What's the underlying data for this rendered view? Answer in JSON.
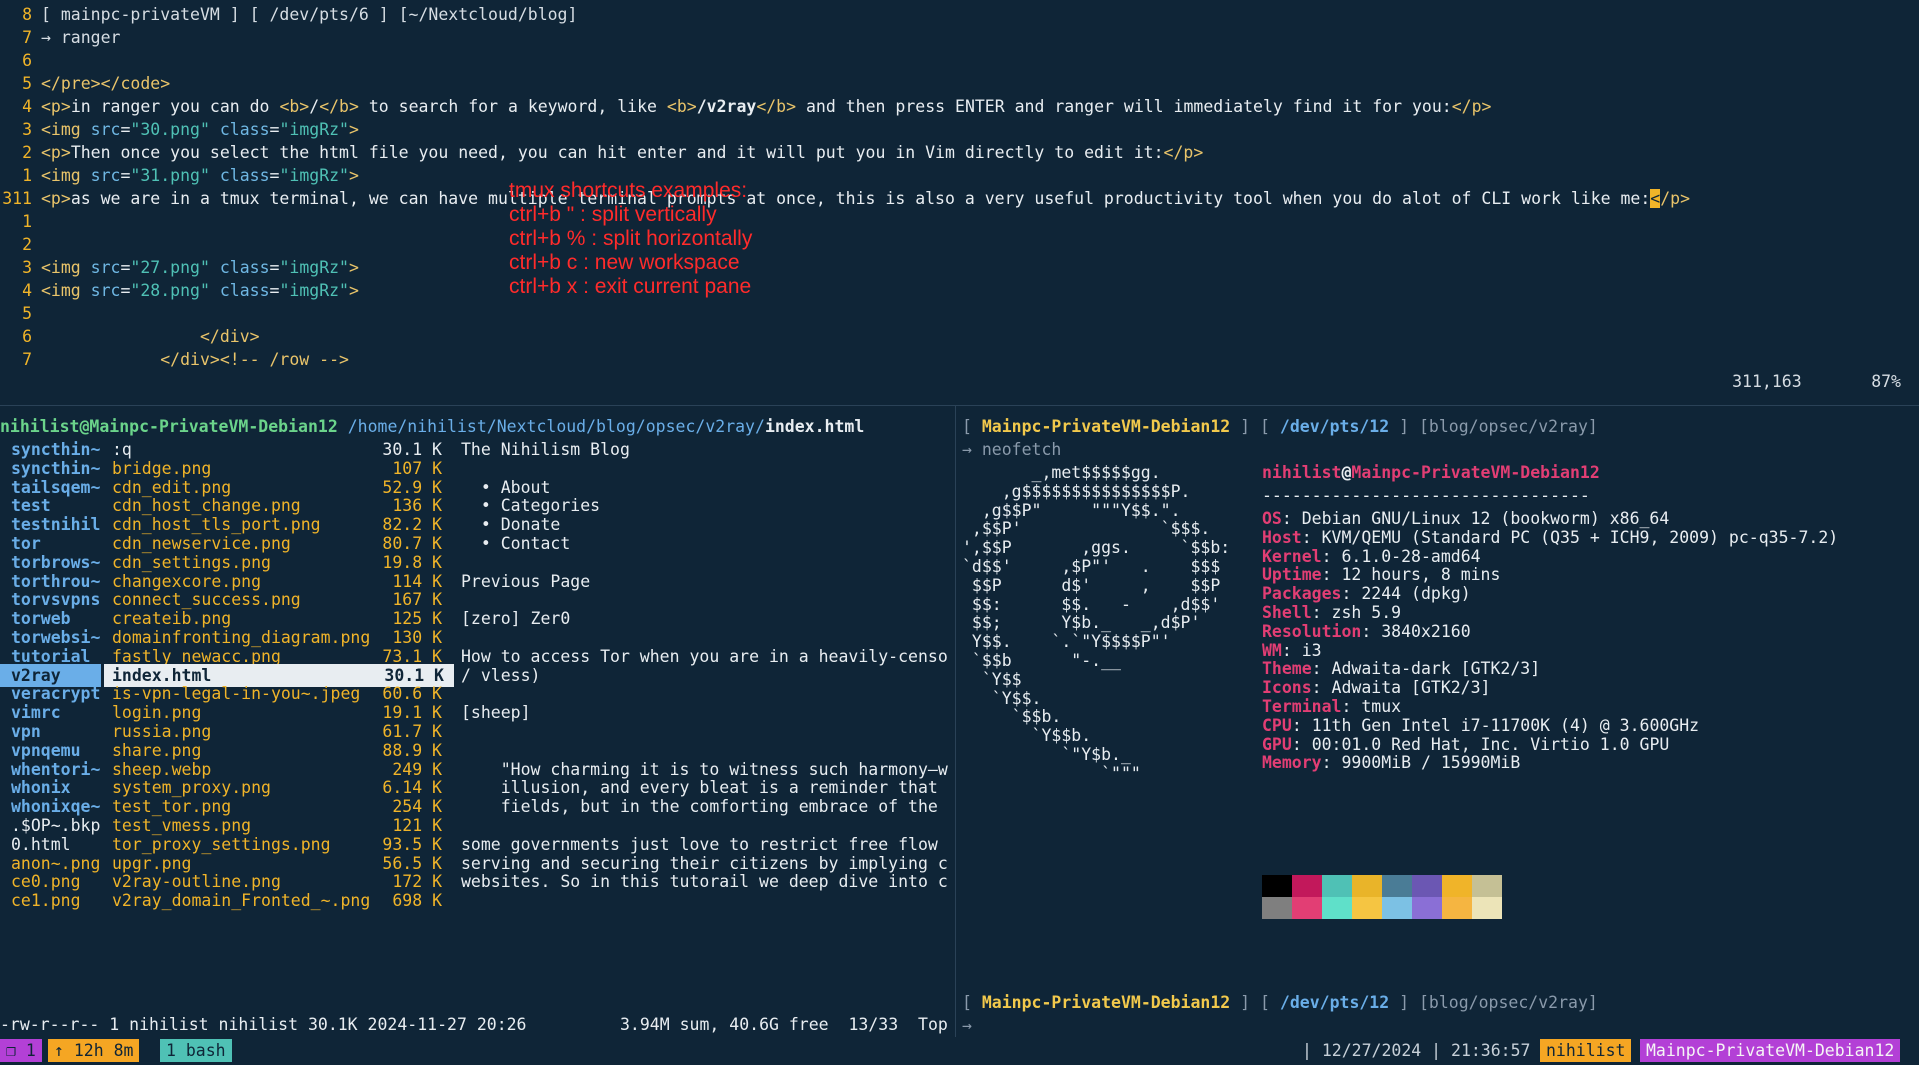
{
  "vim": {
    "lines": [
      {
        "num": "8",
        "html": "[ mainpc-privateVM ] [ /dev/pts/6 ] [~/Nextcloud/blog]"
      },
      {
        "num": "7",
        "html": "→ ranger"
      },
      {
        "num": "6",
        "html": ""
      },
      {
        "num": "5",
        "text": "</pre></code>"
      },
      {
        "num": "4",
        "parts": [
          [
            "tag",
            "<p>"
          ],
          [
            "w",
            "in ranger you can do "
          ],
          [
            "tag",
            "<b>"
          ],
          [
            "w",
            "/"
          ],
          [
            "tag",
            "</b>"
          ],
          [
            "w",
            " to search for a keyword, like "
          ],
          [
            "tag",
            "<b>"
          ],
          [
            "wb",
            "/v2ray"
          ],
          [
            "tag",
            "</b>"
          ],
          [
            "w",
            " and then press ENTER and ranger will immediately find it for you:"
          ],
          [
            "tag",
            "</p>"
          ]
        ]
      },
      {
        "num": "3",
        "parts": [
          [
            "tag",
            "<img "
          ],
          [
            "attr",
            "src"
          ],
          [
            "w",
            "="
          ],
          [
            "str",
            "\"30.png\""
          ],
          [
            "w",
            " "
          ],
          [
            "attr",
            "class"
          ],
          [
            "w",
            "="
          ],
          [
            "str",
            "\"imgRz\""
          ],
          [
            "tag",
            ">"
          ]
        ]
      },
      {
        "num": "2",
        "parts": [
          [
            "tag",
            "<p>"
          ],
          [
            "w",
            "Then once you select the html file you need, you can hit enter and it will put you in Vim directly to edit it:"
          ],
          [
            "tag",
            "</p>"
          ]
        ]
      },
      {
        "num": "1",
        "parts": [
          [
            "tag",
            "<img "
          ],
          [
            "attr",
            "src"
          ],
          [
            "w",
            "="
          ],
          [
            "str",
            "\"31.png\""
          ],
          [
            "w",
            " "
          ],
          [
            "attr",
            "class"
          ],
          [
            "w",
            "="
          ],
          [
            "str",
            "\"imgRz\""
          ],
          [
            "tag",
            ">"
          ]
        ]
      },
      {
        "num": "311",
        "cur": true,
        "parts": [
          [
            "tag",
            "<p>"
          ],
          [
            "w",
            "as we are in a tmux terminal, we can have multiple terminal prompts at once, this is also a very useful productivity tool when you do alot of CLI work like me:"
          ],
          [
            "cursor",
            "<"
          ],
          [
            "tag",
            "/p>"
          ]
        ]
      },
      {
        "num": "1",
        "parts": []
      },
      {
        "num": "2",
        "parts": []
      },
      {
        "num": "3",
        "parts": [
          [
            "tag",
            "<img "
          ],
          [
            "attr",
            "src"
          ],
          [
            "w",
            "="
          ],
          [
            "str",
            "\"27.png\""
          ],
          [
            "w",
            " "
          ],
          [
            "attr",
            "class"
          ],
          [
            "w",
            "="
          ],
          [
            "str",
            "\"imgRz\""
          ],
          [
            "tag",
            ">"
          ]
        ]
      },
      {
        "num": "4",
        "parts": [
          [
            "tag",
            "<img "
          ],
          [
            "attr",
            "src"
          ],
          [
            "w",
            "="
          ],
          [
            "str",
            "\"28.png\""
          ],
          [
            "w",
            " "
          ],
          [
            "attr",
            "class"
          ],
          [
            "w",
            "="
          ],
          [
            "str",
            "\"imgRz\""
          ],
          [
            "tag",
            ">"
          ]
        ]
      },
      {
        "num": "5",
        "parts": []
      },
      {
        "num": "6",
        "parts": [
          [
            "w",
            "                "
          ],
          [
            "tag",
            "</div>"
          ]
        ]
      },
      {
        "num": "7",
        "parts": [
          [
            "w",
            "            "
          ],
          [
            "tag",
            "</div>"
          ],
          [
            "cmt",
            "<!-- /row -->"
          ]
        ]
      }
    ],
    "status_pos": "311,163",
    "status_pct": "87%",
    "annotation": [
      "tmux shortcuts examples:",
      "ctrl+b \" : split vertically",
      "ctrl+b % : split horizontally",
      "ctrl+b c : new workspace",
      "ctrl+b x : exit current pane"
    ]
  },
  "ranger": {
    "header_user": "nihilist@Mainpc-PrivateVM-Debian12",
    "header_path": "/home/nihilist/Nextcloud/blog/opsec/v2ray/",
    "header_file": "index.html",
    "parent_dirs": [
      {
        "name": "syncthin~",
        "type": "dir"
      },
      {
        "name": "syncthin~",
        "type": "dir"
      },
      {
        "name": "tailsqem~",
        "type": "dir"
      },
      {
        "name": "test",
        "type": "dir"
      },
      {
        "name": "testnihil",
        "type": "dir"
      },
      {
        "name": "tor",
        "type": "dir"
      },
      {
        "name": "torbrows~",
        "type": "dir"
      },
      {
        "name": "torthrou~",
        "type": "dir"
      },
      {
        "name": "torvsvpns",
        "type": "dir"
      },
      {
        "name": "torweb",
        "type": "dir"
      },
      {
        "name": "torwebsi~",
        "type": "dir"
      },
      {
        "name": "tutorial",
        "type": "dir"
      },
      {
        "name": "v2ray",
        "type": "sel"
      },
      {
        "name": "veracrypt",
        "type": "dir"
      },
      {
        "name": "vimrc",
        "type": "dir"
      },
      {
        "name": "vpn",
        "type": "dir"
      },
      {
        "name": "vpnqemu",
        "type": "dir"
      },
      {
        "name": "whentori~",
        "type": "dir"
      },
      {
        "name": "whonix",
        "type": "dir"
      },
      {
        "name": "whonixqe~",
        "type": "dir"
      },
      {
        "name": ".$OP~.bkp",
        "type": "plain"
      },
      {
        "name": "0.html",
        "type": "plain"
      },
      {
        "name": "anon~.png",
        "type": "file"
      },
      {
        "name": "ce0.png",
        "type": "file"
      },
      {
        "name": "ce1.png",
        "type": "file"
      }
    ],
    "files": [
      {
        "name": ":q",
        "size": "30.1 K",
        "type": "plain"
      },
      {
        "name": "bridge.png",
        "size": "107 K",
        "type": "file"
      },
      {
        "name": "cdn_edit.png",
        "size": "52.9 K",
        "type": "file"
      },
      {
        "name": "cdn_host_change.png",
        "size": "136 K",
        "type": "file"
      },
      {
        "name": "cdn_host_tls_port.png",
        "size": "82.2 K",
        "type": "file"
      },
      {
        "name": "cdn_newservice.png",
        "size": "80.7 K",
        "type": "file"
      },
      {
        "name": "cdn_settings.png",
        "size": "19.8 K",
        "type": "file"
      },
      {
        "name": "changexcore.png",
        "size": "114 K",
        "type": "file"
      },
      {
        "name": "connect_success.png",
        "size": "167 K",
        "type": "file"
      },
      {
        "name": "createib.png",
        "size": "125 K",
        "type": "file"
      },
      {
        "name": "domainfronting_diagram.png",
        "size": "130 K",
        "type": "file"
      },
      {
        "name": "fastly_newacc.png",
        "size": "73.1 K",
        "type": "file"
      },
      {
        "name": "index.html",
        "size": "30.1 K",
        "type": "sel"
      },
      {
        "name": "is-vpn-legal-in-you~.jpeg",
        "size": "60.6 K",
        "type": "file"
      },
      {
        "name": "login.png",
        "size": "19.1 K",
        "type": "file"
      },
      {
        "name": "russia.png",
        "size": "61.7 K",
        "type": "file"
      },
      {
        "name": "share.png",
        "size": "88.9 K",
        "type": "file"
      },
      {
        "name": "sheep.webp",
        "size": "249 K",
        "type": "file"
      },
      {
        "name": "system_proxy.png",
        "size": "6.14 K",
        "type": "file"
      },
      {
        "name": "test_tor.png",
        "size": "254 K",
        "type": "file"
      },
      {
        "name": "test_vmess.png",
        "size": "121 K",
        "type": "file"
      },
      {
        "name": "tor_proxy_settings.png",
        "size": "93.5 K",
        "type": "file"
      },
      {
        "name": "upgr.png",
        "size": "56.5 K",
        "type": "file"
      },
      {
        "name": "v2ray-outline.png",
        "size": "172 K",
        "type": "file"
      },
      {
        "name": "v2ray_domain_Fronted_~.png",
        "size": "698 K",
        "type": "file"
      }
    ],
    "preview": [
      "The Nihilism Blog",
      "",
      "  • About",
      "  • Categories",
      "  • Donate",
      "  • Contact",
      "",
      "Previous Page",
      "",
      "[zero] Zer0",
      "",
      "How to access Tor when you are in a heavily-censo",
      "/ vless)",
      "",
      "[sheep]",
      "",
      "",
      "    \"How charming it is to witness such harmony—w",
      "    illusion, and every bleat is a reminder that",
      "    fields, but in the comforting embrace of the",
      "",
      "some governments just love to restrict free flow",
      "serving and securing their citizens by implying c",
      "websites. So in this tutorail we deep dive into c"
    ],
    "footer_left": "-rw-r--r-- 1 nihilist nihilist 30.1K 2024-11-27 20:26",
    "footer_right": "3.94M sum, 40.6G free  13/33  Top"
  },
  "neofetch": {
    "prompt_host": "Mainpc-PrivateVM-Debian12",
    "prompt_tty": "/dev/pts/12",
    "prompt_dir": "[blog/opsec/v2ray]",
    "command": "→ neofetch",
    "ascii": [
      "       _,met$$$$$gg.",
      "    ,g$$$$$$$$$$$$$$$P.",
      "  ,g$$P\"     \"\"\"Y$$.\".",
      " ,$$P'              `$$$.",
      "',$$P       ,ggs.     `$$b:",
      "`d$$'     ,$P\"'   .    $$$",
      " $$P      d$'     ,    $$P",
      " $$:      $$.   -    ,d$$'",
      " $$;      Y$b._   _,d$P'",
      " Y$$.    `.`\"Y$$$$P\"'",
      " `$$b      \"-.__",
      "  `Y$$",
      "   `Y$$.",
      "     `$$b.",
      "       `Y$$b.",
      "          `\"Y$b._",
      "              `\"\"\""
    ],
    "title_user": "nihilist",
    "title_host": "Mainpc-PrivateVM-Debian12",
    "separator": "---------------------------------",
    "info": [
      {
        "key": "OS",
        "val": "Debian GNU/Linux 12 (bookworm) x86_64"
      },
      {
        "key": "Host",
        "val": "KVM/QEMU (Standard PC (Q35 + ICH9, 2009) pc-q35-7.2)"
      },
      {
        "key": "Kernel",
        "val": "6.1.0-28-amd64"
      },
      {
        "key": "Uptime",
        "val": "12 hours, 8 mins"
      },
      {
        "key": "Packages",
        "val": "2244 (dpkg)"
      },
      {
        "key": "Shell",
        "val": "zsh 5.9"
      },
      {
        "key": "Resolution",
        "val": "3840x2160"
      },
      {
        "key": "WM",
        "val": "i3"
      },
      {
        "key": "Theme",
        "val": "Adwaita-dark [GTK2/3]"
      },
      {
        "key": "Icons",
        "val": "Adwaita [GTK2/3]"
      },
      {
        "key": "Terminal",
        "val": "tmux"
      },
      {
        "key": "CPU",
        "val": "11th Gen Intel i7-11700K (4) @ 3.600GHz"
      },
      {
        "key": "GPU",
        "val": "00:01.0 Red Hat, Inc. Virtio 1.0 GPU"
      },
      {
        "key": "Memory",
        "val": "9900MiB / 15990MiB"
      }
    ],
    "palette_top": [
      "#000000",
      "#c2185b",
      "#4fc1b5",
      "#e9b429",
      "#4a7c96",
      "#6b57b3",
      "#f0b429",
      "#c5c095"
    ],
    "palette_bottom": [
      "#7f7f7f",
      "#e23e74",
      "#5fe0c9",
      "#f5c542",
      "#7cc1e4",
      "#8a6fd6",
      "#f5b541",
      "#ece4b8"
    ],
    "prompt2_host": "Mainpc-PrivateVM-Debian12",
    "prompt2_tty": "/dev/pts/12",
    "prompt2_dir": "[blog/opsec/v2ray]",
    "prompt2_arrow": "→"
  },
  "statusbar": {
    "session": "❐ 1",
    "uptime": "↑ 12h 8m",
    "window": "1 bash",
    "datetime": "| 12/27/2024 | 21:36:57",
    "user": "nihilist",
    "host": "Mainpc-PrivateVM-Debian12"
  }
}
